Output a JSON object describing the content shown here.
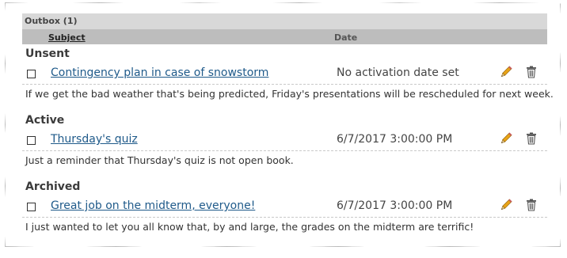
{
  "outbox": {
    "title": "Outbox (1)",
    "columns": {
      "subject": "Subject",
      "date": "Date"
    }
  },
  "sections": [
    {
      "title": "Unsent",
      "subject": "Contingency plan in case of snowstorm",
      "date": "No activation date set",
      "message": "If we get the bad weather that's being predicted, Friday's presentations will be rescheduled for next week."
    },
    {
      "title": "Active",
      "subject": "Thursday's quiz",
      "date": "6/7/2017 3:00:00 PM",
      "message": "Just a reminder that Thursday's quiz is not open book."
    },
    {
      "title": "Archived",
      "subject": "Great job on the midterm, everyone!",
      "date": "6/7/2017 3:00:00 PM",
      "message": "I just wanted to let you all know that, by and large, the grades on the midterm are terrific!"
    }
  ],
  "icons": {
    "edit": "pencil-icon",
    "delete": "trash-icon"
  },
  "colors": {
    "link": "#1f5a8a",
    "header_bg": "#d8d8d8",
    "column_header_bg": "#bdbdbd",
    "pencil": "#e8a317"
  }
}
